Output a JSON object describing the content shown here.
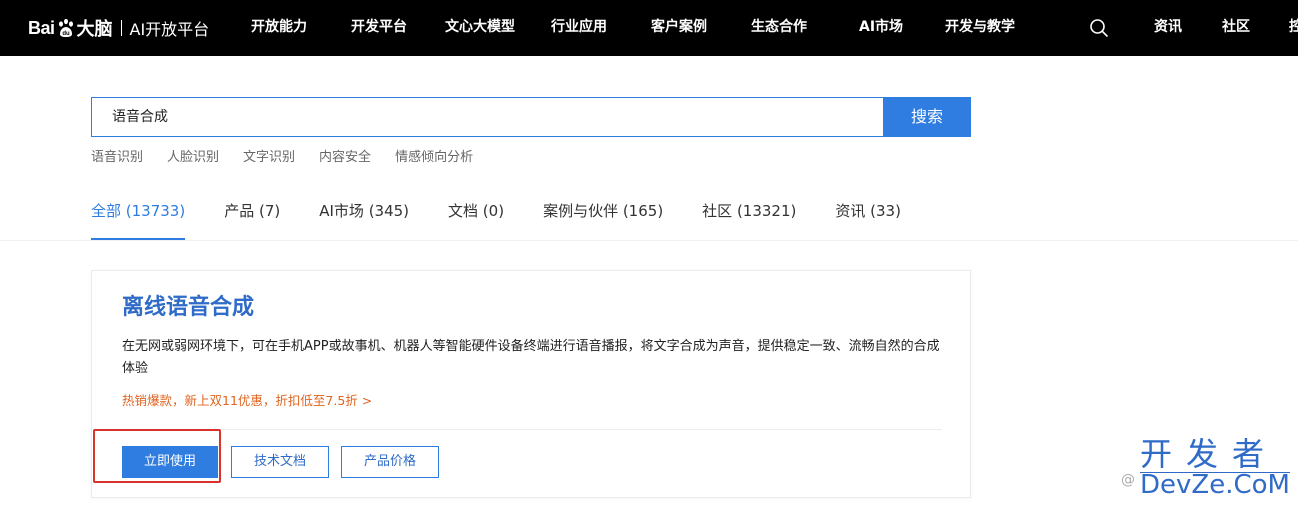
{
  "brand": {
    "bai": "Bai",
    "du": "大脑",
    "platform": "AI开放平台"
  },
  "nav": {
    "items": [
      "开放能力",
      "开发平台",
      "文心大模型",
      "行业应用",
      "客户案例",
      "生态合作",
      "AI市场",
      "开发与教学"
    ],
    "right_items": [
      "资讯",
      "社区",
      "控"
    ]
  },
  "search": {
    "query": "语音合成",
    "button_label": "搜索",
    "hot_words": [
      "语音识别",
      "人脸识别",
      "文字识别",
      "内容安全",
      "情感倾向分析"
    ]
  },
  "tabs": [
    {
      "label": "全部 (13733)",
      "active": true
    },
    {
      "label": "产品 (7)",
      "active": false
    },
    {
      "label": "AI市场 (345)",
      "active": false
    },
    {
      "label": "文档 (0)",
      "active": false
    },
    {
      "label": "案例与伙伴 (165)",
      "active": false
    },
    {
      "label": "社区 (13321)",
      "active": false
    },
    {
      "label": "资讯 (33)",
      "active": false
    }
  ],
  "result": {
    "title": "离线语音合成",
    "description": "在无网或弱网环境下，可在手机APP或故事机、机器人等智能硬件设备终端进行语音播报，将文字合成为声音，提供稳定一致、流畅自然的合成体验",
    "promo": "热销爆款，新上双11优惠，折扣低至7.5折 >",
    "buttons": {
      "use": "立即使用",
      "docs": "技术文档",
      "price": "产品价格"
    }
  },
  "watermark": {
    "cn": "开发者",
    "en": "DevZe.CoM",
    "at": "@"
  },
  "colors": {
    "accent": "#2f7de1",
    "title": "#2f6bc7",
    "promo": "#e06420",
    "highlight": "#d9342b",
    "nav_bg": "#000000"
  }
}
